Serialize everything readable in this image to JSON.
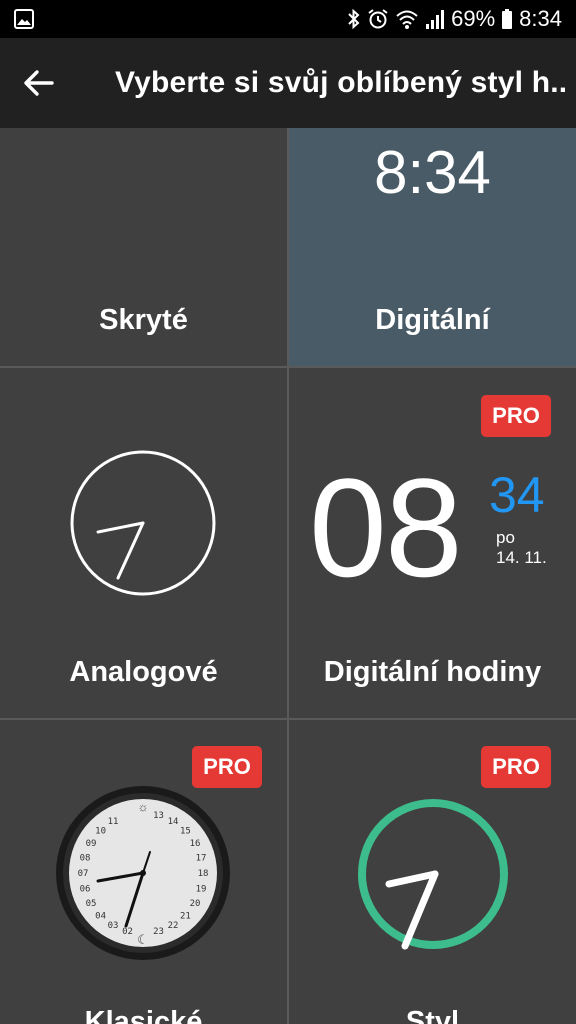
{
  "status_bar": {
    "battery": "69%",
    "time": "8:34",
    "icons": [
      "image-icon",
      "bluetooth-icon",
      "alarm-icon",
      "wifi-icon",
      "signal-icon",
      "battery-icon"
    ]
  },
  "app_bar": {
    "title": "Vyberte si svůj oblíbený styl h...",
    "back_icon": "arrow-left-icon"
  },
  "styles": [
    {
      "label": "Skryté"
    },
    {
      "label": "Digitální",
      "time": "8:34",
      "selected": true
    },
    {
      "label": "Analogové"
    },
    {
      "label": "Digitální hodiny",
      "pro": "PRO",
      "hour": "08",
      "minute": "34",
      "day": "po",
      "date": "14. 11."
    },
    {
      "label": "Klasické",
      "pro": "PRO",
      "dial_numbers": [
        "13",
        "14",
        "15",
        "16",
        "17",
        "18",
        "19",
        "20",
        "21",
        "22",
        "23",
        "11",
        "10",
        "09",
        "08",
        "07",
        "06",
        "05",
        "04",
        "03",
        "02"
      ]
    },
    {
      "label": "Styl",
      "pro": "PRO"
    }
  ],
  "colors": {
    "accent_blue": "#2196f3",
    "pro_red": "#e53935",
    "selected_bg": "#485b67",
    "ring_green": "#3dbd8d"
  }
}
